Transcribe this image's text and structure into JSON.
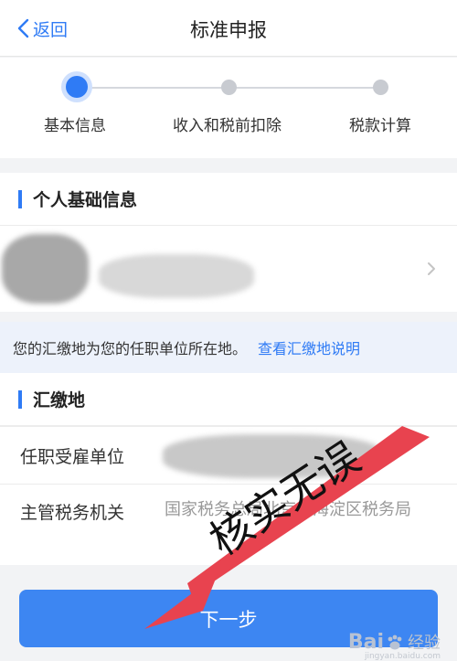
{
  "nav": {
    "back_label": "返回",
    "title": "标准申报"
  },
  "steps": {
    "items": [
      {
        "label": "基本信息",
        "state": "active"
      },
      {
        "label": "收入和税前扣除",
        "state": "pending"
      },
      {
        "label": "税款计算",
        "state": "pending"
      }
    ]
  },
  "personal": {
    "title": "个人基础信息"
  },
  "notice": {
    "text": "您的汇缴地为您的任职单位所在地。",
    "link": "查看汇缴地说明"
  },
  "remit": {
    "title": "汇缴地",
    "employer_label": "任职受雇单位",
    "authority_label": "主管税务机关",
    "authority_value": "国家税务总局北京市海淀区税务局"
  },
  "actions": {
    "next_label": "下一步"
  },
  "annotation": {
    "text": "核实无误",
    "color": "#e8434f"
  },
  "watermark": {
    "brand": "Bai",
    "text": "经验",
    "url": "jingyan.baidu.com"
  },
  "colors": {
    "accent": "#2f7bf5",
    "button": "#3d86f2",
    "annotation": "#e8434f"
  }
}
